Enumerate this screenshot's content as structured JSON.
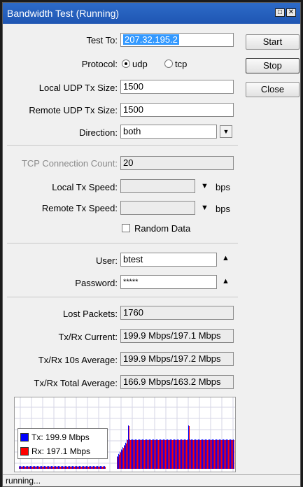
{
  "window": {
    "title": "Bandwidth Test (Running)"
  },
  "buttons": {
    "start": "Start",
    "stop": "Stop",
    "close": "Close"
  },
  "form": {
    "test_to_label": "Test To:",
    "test_to_value": "207.32.195.2",
    "protocol_label": "Protocol:",
    "protocol_udp": "udp",
    "protocol_tcp": "tcp",
    "protocol_selected": "udp",
    "local_udp_label": "Local UDP Tx Size:",
    "local_udp_value": "1500",
    "remote_udp_label": "Remote UDP Tx Size:",
    "remote_udp_value": "1500",
    "direction_label": "Direction:",
    "direction_value": "both",
    "tcp_count_label": "TCP Connection Count:",
    "tcp_count_value": "20",
    "local_tx_label": "Local Tx Speed:",
    "local_tx_value": "",
    "local_tx_unit": "bps",
    "remote_tx_label": "Remote Tx Speed:",
    "remote_tx_value": "",
    "remote_tx_unit": "bps",
    "random_data_label": "Random Data",
    "random_data_checked": false,
    "user_label": "User:",
    "user_value": "btest",
    "password_label": "Password:",
    "password_value": "*****"
  },
  "stats": {
    "lost_label": "Lost Packets:",
    "lost_value": "1760",
    "current_label": "Tx/Rx Current:",
    "current_value": "199.9 Mbps/197.1 Mbps",
    "avg10_label": "Tx/Rx 10s Average:",
    "avg10_value": "199.9 Mbps/197.2 Mbps",
    "total_label": "Tx/Rx Total Average:",
    "total_value": "166.9 Mbps/163.2 Mbps"
  },
  "graph": {
    "tx_label": "Tx:  199.9 Mbps",
    "rx_label": "Rx:  197.1 Mbps",
    "tx_color": "#0000ff",
    "rx_color": "#ff0000"
  },
  "status": {
    "text": "running..."
  }
}
